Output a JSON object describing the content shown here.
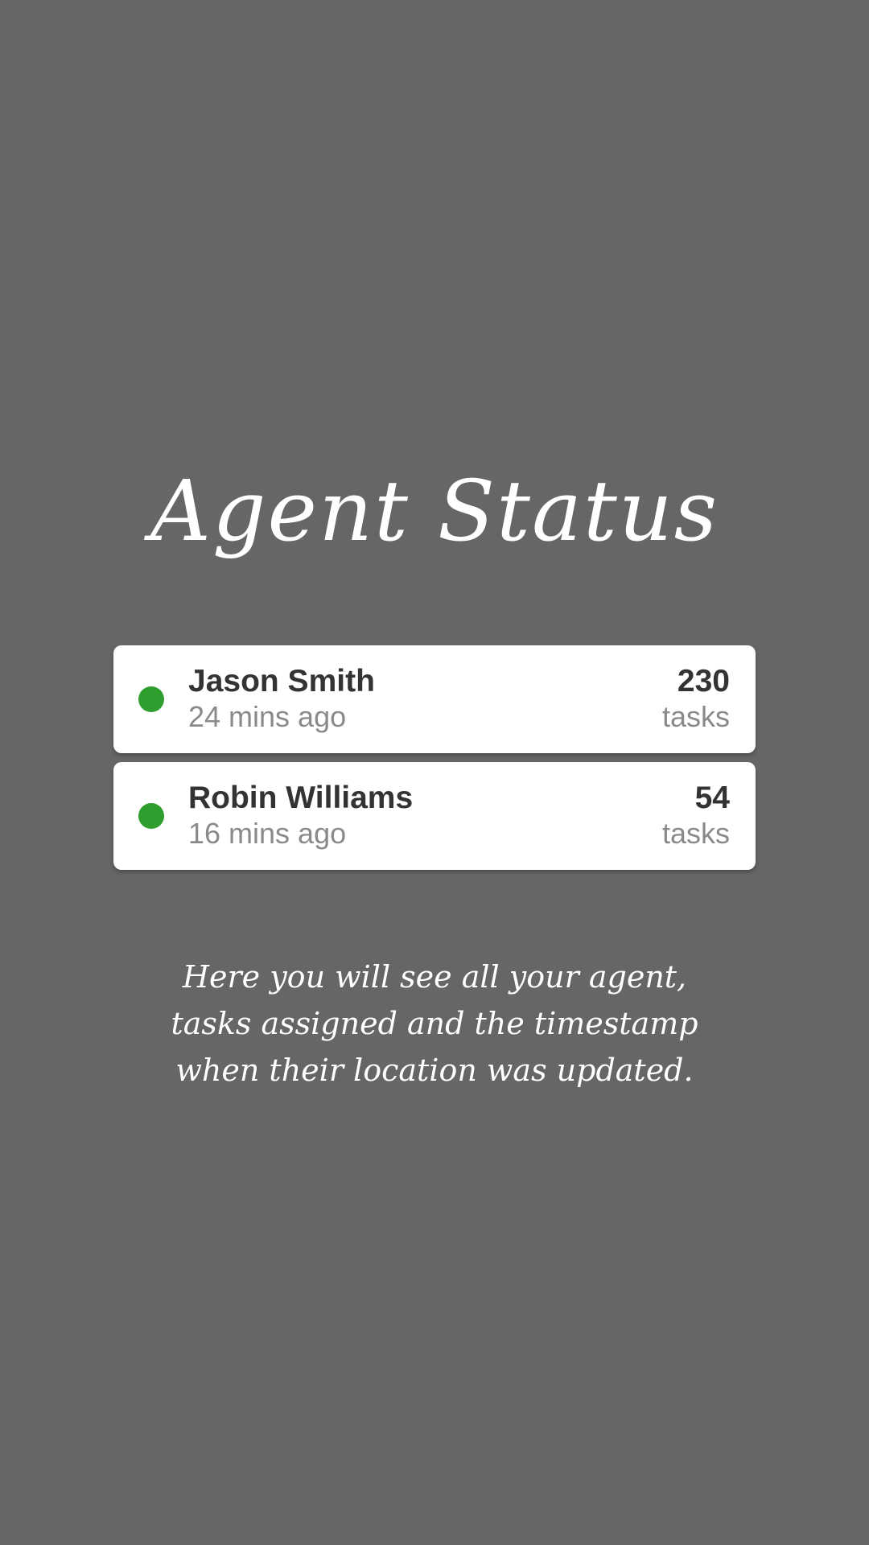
{
  "page": {
    "title": "Agent Status",
    "description": "Here you will see all your agent, tasks assigned and the timestamp when their location was updated."
  },
  "colors": {
    "background": "#666666",
    "card": "#ffffff",
    "status_online": "#2e9e2e",
    "primary_text": "#333333",
    "secondary_text": "#8a8a8a"
  },
  "agents": [
    {
      "name": "Jason Smith",
      "last_update": "24 mins ago",
      "task_count": "230",
      "task_unit": "tasks",
      "status_icon": "status-online-dot"
    },
    {
      "name": "Robin Williams",
      "last_update": "16 mins ago",
      "task_count": "54",
      "task_unit": "tasks",
      "status_icon": "status-online-dot"
    }
  ]
}
